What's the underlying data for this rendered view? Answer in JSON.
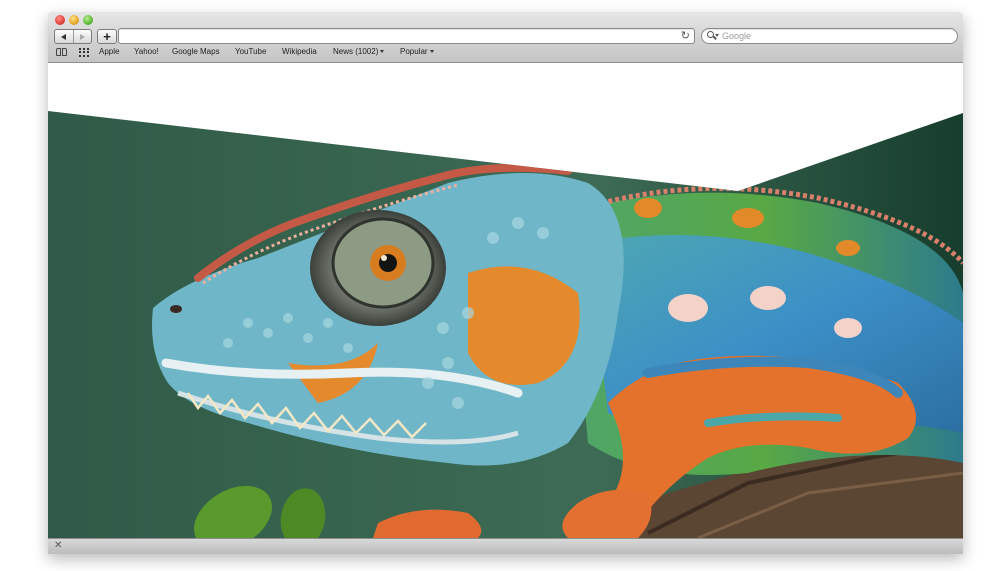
{
  "browser": {
    "url": "",
    "search": {
      "placeholder": "Google",
      "value": ""
    },
    "bookmarks": [
      {
        "label": "Apple",
        "has_menu": false
      },
      {
        "label": "Yahoo!",
        "has_menu": false
      },
      {
        "label": "Google Maps",
        "has_menu": false
      },
      {
        "label": "YouTube",
        "has_menu": false
      },
      {
        "label": "Wikipedia",
        "has_menu": false
      },
      {
        "label": "News (1002)",
        "has_menu": true
      },
      {
        "label": "Popular",
        "has_menu": true
      }
    ],
    "toolbar": {
      "new_tab_label": "+",
      "reload_glyph": "↻"
    },
    "status": {
      "close_glyph": "✕"
    }
  },
  "content": {
    "image_subject": "chameleon-photo",
    "colors": {
      "background_green": "#2f5a47",
      "dark_green": "#173d2d",
      "page_white": "#ffffff"
    }
  }
}
